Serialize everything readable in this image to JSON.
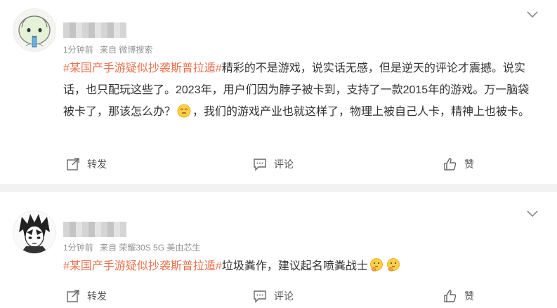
{
  "posts": [
    {
      "meta": {
        "time": "1分钟前",
        "source": "来自 微博搜索"
      },
      "content": {
        "topic": "#某国产手游疑似抄袭斯普拉遁#",
        "text1": "精彩的不是游戏，说实话无感，但是逆天的评论才震撼。说实话，也只配玩这些了。2023年，用户们因为脖子被卡到，支持了一款2015年的游戏。万一脑袋被卡了，那该怎么办？",
        "text2": "，我们的游戏产业也就这样了，物理上被自己人卡，精神上也被卡。",
        "emoji": "squinting-face"
      },
      "actions": {
        "repost": "转发",
        "comment": "评论",
        "like": "赞"
      }
    },
    {
      "meta": {
        "time": "1分钟前",
        "source": "来自 荣耀30S 5G 美由芯生"
      },
      "content": {
        "topic": "#某国产手游疑似抄袭斯普拉遁#",
        "text1": "垃圾粪作，建议起名喷粪战士",
        "emoji": "thinking-face"
      },
      "actions": {
        "repost": "转发",
        "comment": "评论",
        "like": "赞"
      }
    }
  ],
  "colors": {
    "topic": "#eb7350",
    "meta": "#939393",
    "divider": "#f2f2f2"
  }
}
